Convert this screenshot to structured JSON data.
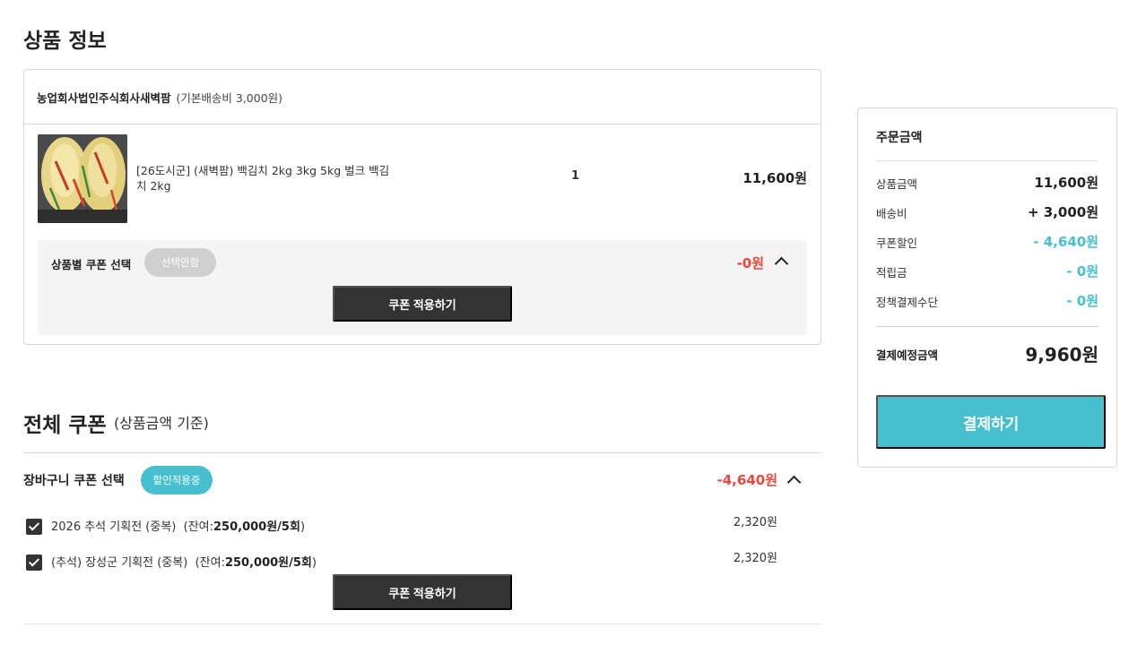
{
  "product_section": {
    "title": "상품 정보",
    "seller": {
      "name": "농업회사법인주식회사새벽팜",
      "shipping": "(기본배송비 3,000원)"
    },
    "item": {
      "image": "kimchi-product-photo",
      "name": "[26도시군] (새벽팜) 백김치 2kg 3kg 5kg 벌크 백김치 2kg",
      "qty": "1",
      "price": "11,600원"
    },
    "coupon": {
      "label": "상품별 쿠폰 선택",
      "state": "선택안함",
      "amount": "-0원",
      "apply_button": "쿠폰 적용하기"
    }
  },
  "all_coupon": {
    "title": "전체 쿠폰",
    "subtitle": "(상품금액 기준)",
    "cart_label": "장바구니 쿠폰 선택",
    "state": "할인적용중",
    "amount": "-4,640원",
    "items": [
      {
        "name": "2026 추석 기획전 (중복)",
        "remain_prefix": "(잔여:",
        "remain_value": "250,000원/5회",
        "remain_suffix": ")",
        "value": "2,320원",
        "checked": true
      },
      {
        "name": "(추석) 장성군 기획전 (중복)",
        "remain_prefix": "(잔여:",
        "remain_value": "250,000원/5회",
        "remain_suffix": ")",
        "value": "2,320원",
        "checked": true
      }
    ],
    "apply_button": "쿠폰 적용하기"
  },
  "summary": {
    "title": "주문금액",
    "rows": [
      {
        "label": "상품금액",
        "value": "11,600원"
      },
      {
        "label": "배송비",
        "value": "+ 3,000원"
      },
      {
        "label": "쿠폰할인",
        "value": "- 4,640원"
      },
      {
        "label": "적립금",
        "value": "- 0원"
      },
      {
        "label": "정책결제수단",
        "value": "- 0원"
      }
    ],
    "total_label": "결제예정금액",
    "total_value": "9,960원",
    "pay_button": "결제하기"
  },
  "colors": {
    "accent": "#46bfcf",
    "discount_red": "#e8473c",
    "dark_button": "#333333"
  }
}
